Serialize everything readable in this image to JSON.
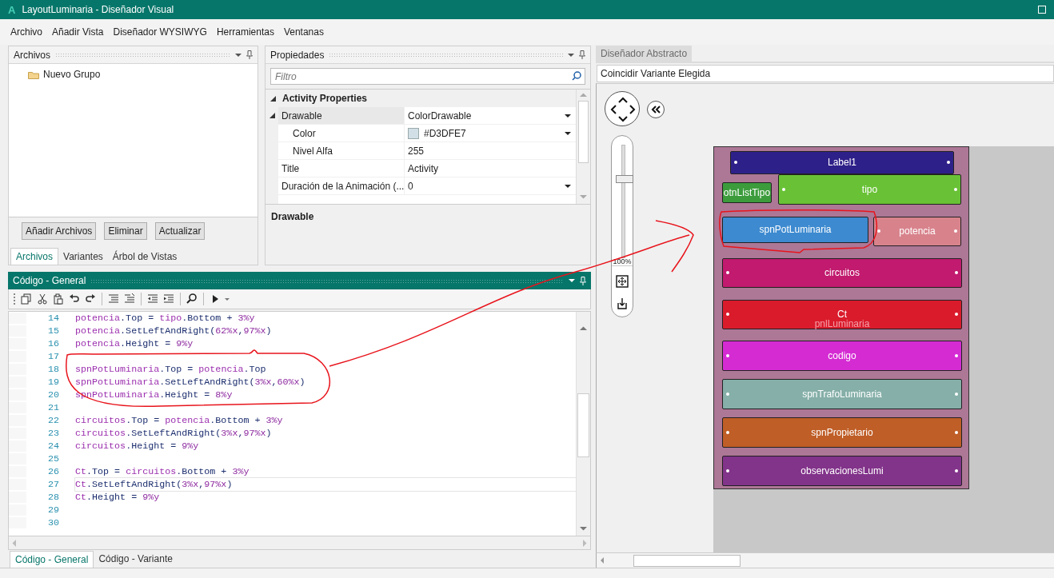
{
  "window": {
    "logo": "A",
    "title": "LayoutLuminaria - Diseñador Visual"
  },
  "menu": [
    "Archivo",
    "Añadir Vista",
    "Diseñador WYSIWYG",
    "Herramientas",
    "Ventanas"
  ],
  "files_panel": {
    "title": "Archivos",
    "tree": [
      {
        "label": "Nuevo Grupo"
      }
    ],
    "buttons": [
      "Añadir Archivos",
      "Eliminar",
      "Actualizar"
    ],
    "tabs": [
      {
        "label": "Archivos",
        "selected": true
      },
      {
        "label": "Variantes",
        "selected": false
      },
      {
        "label": "Árbol de Vistas",
        "selected": false
      }
    ]
  },
  "properties_panel": {
    "title": "Propiedades",
    "filter": {
      "placeholder": "Filtro"
    },
    "category": {
      "label": "Activity Properties",
      "expanded": true
    },
    "rows": [
      {
        "name": "Drawable",
        "value": "ColorDrawable",
        "dropdown": true,
        "selected": true,
        "expanded": true,
        "children": [
          {
            "name": "Color",
            "value": "#D3DFE7",
            "color": "#d3dfe7",
            "dropdown": true,
            "selected": false
          },
          {
            "name": "Nivel Alfa",
            "value": "255",
            "dropdown": false,
            "selected": false
          }
        ]
      },
      {
        "name": "Title",
        "value": "Activity",
        "dropdown": false,
        "selected": false
      },
      {
        "name": "Duración de la Animación (...",
        "value": "0",
        "dropdown": true,
        "selected": false
      }
    ],
    "description": "Drawable"
  },
  "code_panel": {
    "title": "Código - General",
    "lines": [
      {
        "number": "14",
        "current": false,
        "tokens": [
          {
            "text": "potencia",
            "kind": "obj"
          },
          {
            "text": ".Top = ",
            "kind": "member"
          },
          {
            "text": "tipo",
            "kind": "obj"
          },
          {
            "text": ".Bottom + ",
            "kind": "member"
          },
          {
            "text": "3%y",
            "kind": "num"
          }
        ]
      },
      {
        "number": "15",
        "current": false,
        "tokens": [
          {
            "text": "potencia",
            "kind": "obj"
          },
          {
            "text": ".SetLeftAndRight(",
            "kind": "member"
          },
          {
            "text": "62%x",
            "kind": "num"
          },
          {
            "text": ",",
            "kind": "member"
          },
          {
            "text": "97%x",
            "kind": "num"
          },
          {
            "text": ")",
            "kind": "member"
          }
        ]
      },
      {
        "number": "16",
        "current": false,
        "tokens": [
          {
            "text": "potencia",
            "kind": "obj"
          },
          {
            "text": ".Height = ",
            "kind": "member"
          },
          {
            "text": "9%y",
            "kind": "num"
          }
        ]
      },
      {
        "number": "17",
        "current": false
      },
      {
        "number": "18",
        "current": false,
        "tokens": [
          {
            "text": "spnPotLuminaria",
            "kind": "obj"
          },
          {
            "text": ".Top = ",
            "kind": "member"
          },
          {
            "text": "potencia",
            "kind": "obj"
          },
          {
            "text": ".Top",
            "kind": "member"
          }
        ]
      },
      {
        "number": "19",
        "current": false,
        "tokens": [
          {
            "text": "spnPotLuminaria",
            "kind": "obj"
          },
          {
            "text": ".SetLeftAndRight(",
            "kind": "member"
          },
          {
            "text": "3%x",
            "kind": "num"
          },
          {
            "text": ",",
            "kind": "member"
          },
          {
            "text": "60%x",
            "kind": "num"
          },
          {
            "text": ")",
            "kind": "member"
          }
        ]
      },
      {
        "number": "20",
        "current": false,
        "tokens": [
          {
            "text": "spnPotLuminaria",
            "kind": "obj"
          },
          {
            "text": ".Height = ",
            "kind": "member"
          },
          {
            "text": "8%y",
            "kind": "num"
          }
        ]
      },
      {
        "number": "21",
        "current": false
      },
      {
        "number": "22",
        "current": false,
        "tokens": [
          {
            "text": "circuitos",
            "kind": "obj"
          },
          {
            "text": ".Top = ",
            "kind": "member"
          },
          {
            "text": "potencia",
            "kind": "obj"
          },
          {
            "text": ".Bottom + ",
            "kind": "member"
          },
          {
            "text": "3%y",
            "kind": "num"
          }
        ]
      },
      {
        "number": "23",
        "current": false,
        "tokens": [
          {
            "text": "circuitos",
            "kind": "obj"
          },
          {
            "text": ".SetLeftAndRight(",
            "kind": "member"
          },
          {
            "text": "3%x",
            "kind": "num"
          },
          {
            "text": ",",
            "kind": "member"
          },
          {
            "text": "97%x",
            "kind": "num"
          },
          {
            "text": ")",
            "kind": "member"
          }
        ]
      },
      {
        "number": "24",
        "current": false,
        "tokens": [
          {
            "text": "circuitos",
            "kind": "obj"
          },
          {
            "text": ".Height = ",
            "kind": "member"
          },
          {
            "text": "9%y",
            "kind": "num"
          }
        ]
      },
      {
        "number": "25",
        "current": false
      },
      {
        "number": "26",
        "current": false,
        "tokens": [
          {
            "text": "Ct",
            "kind": "obj"
          },
          {
            "text": ".Top = ",
            "kind": "member"
          },
          {
            "text": "circuitos",
            "kind": "obj"
          },
          {
            "text": ".Bottom + ",
            "kind": "member"
          },
          {
            "text": "3%y",
            "kind": "num"
          }
        ]
      },
      {
        "number": "27",
        "current": true,
        "tokens": [
          {
            "text": "Ct",
            "kind": "obj"
          },
          {
            "text": ".SetLeftAndRight(",
            "kind": "member"
          },
          {
            "text": "3%x",
            "kind": "num"
          },
          {
            "text": ",",
            "kind": "member"
          },
          {
            "text": "97%x",
            "kind": "num"
          },
          {
            "text": ")",
            "kind": "member"
          }
        ]
      },
      {
        "number": "28",
        "current": false,
        "tokens": [
          {
            "text": "Ct",
            "kind": "obj"
          },
          {
            "text": ".Height = ",
            "kind": "member"
          },
          {
            "text": "9%y",
            "kind": "num"
          }
        ]
      },
      {
        "number": "29",
        "current": false
      },
      {
        "number": "30",
        "current": false
      }
    ],
    "tabs": [
      {
        "label": "Código - General",
        "selected": true
      },
      {
        "label": "Código - Variante",
        "selected": false
      }
    ]
  },
  "designer": {
    "tab": {
      "label": "Diseñador Abstracto",
      "selected": true
    },
    "variant_field": {
      "value": "Coincidir Variante Elegida"
    },
    "zoom": {
      "level": 0.7,
      "reading": "100%"
    },
    "form": {
      "name": "pnlLuminaria",
      "widgets": [
        {
          "label": "Label1",
          "color": "#2e2089",
          "anchors": true
        },
        {
          "label": "otnListTipo",
          "color": "#3c9c3c",
          "anchors": false
        },
        {
          "label": "tipo",
          "color": "#69c236",
          "anchors": true
        },
        {
          "label": "spnPotLuminaria",
          "color": "#3d8ad0",
          "anchors": false
        },
        {
          "label": "potencia",
          "color": "#d8838c",
          "anchors": true
        },
        {
          "label": "circuitos",
          "color": "#c11a6e",
          "anchors": true
        },
        {
          "label": "Ct",
          "color": "#da1b2c",
          "anchors": true
        },
        {
          "label": "codigo",
          "color": "#d52bd3",
          "anchors": true
        },
        {
          "label": "spnTrafoLuminaria",
          "color": "#85afa8",
          "anchors": true
        },
        {
          "label": "spnPropietario",
          "color": "#bf5e27",
          "anchors": true
        },
        {
          "label": "observacionesLumi",
          "color": "#82338a",
          "anchors": true
        }
      ]
    }
  }
}
